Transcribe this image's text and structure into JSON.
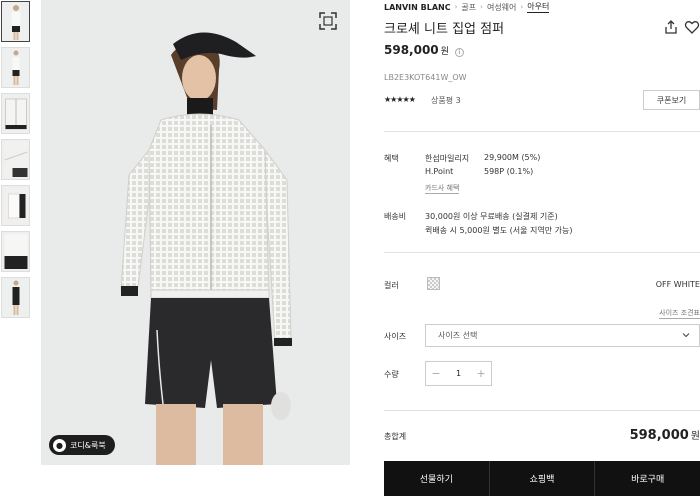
{
  "thumbnails": [
    "thumbnail-1",
    "thumbnail-2",
    "thumbnail-3",
    "thumbnail-4",
    "thumbnail-5",
    "thumbnail-6",
    "thumbnail-7"
  ],
  "coordi_label": "코디&룩북",
  "breadcrumb": {
    "brand": "LANVIN BLANC",
    "items": [
      "골프",
      "여성웨어",
      "아우터"
    ]
  },
  "product": {
    "title": "크로셰 니트 집업 점퍼",
    "price": "598,000",
    "price_unit": "원",
    "code": "LB2E3KOT641W_OW",
    "stars": "★★★★★",
    "review": "상품평 3",
    "coupon_label": "쿠폰보기"
  },
  "benefits": {
    "label": "혜택",
    "rows": [
      {
        "name": "한섬마일리지",
        "value": "29,900M (5%)"
      },
      {
        "name": "H.Point",
        "value": "598P (0.1%)"
      }
    ],
    "card_link": "카드사 혜택"
  },
  "shipping": {
    "label": "배송비",
    "line1": "30,000원 이상 무료배송 (실결제 기준)",
    "line2": "퀵배송 시 5,000원 별도 (서울 지역만 가능)"
  },
  "color": {
    "label": "컬러",
    "value": "OFF WHITE",
    "size_guide": "사이즈 조견표"
  },
  "size": {
    "label": "사이즈",
    "placeholder": "사이즈 선택"
  },
  "quantity": {
    "label": "수량",
    "minus": "−",
    "value": "1",
    "plus": "+"
  },
  "total": {
    "label": "총합계",
    "value": "598,000",
    "unit": "원"
  },
  "cta": {
    "gift": "선물하기",
    "cart": "쇼핑백",
    "buy": "바로구매"
  }
}
